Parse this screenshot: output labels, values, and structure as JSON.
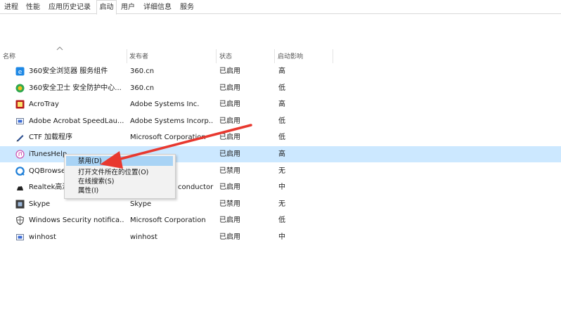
{
  "tabs": [
    "进程",
    "性能",
    "应用历史记录",
    "启动",
    "用户",
    "详细信息",
    "服务"
  ],
  "active_tab": "启动",
  "columns": {
    "name": "名称",
    "publisher": "发布者",
    "status": "状态",
    "impact": "启动影响"
  },
  "rows": [
    {
      "name": "360安全浏览器 服务组件",
      "publisher": "360.cn",
      "status": "已启用",
      "impact": "高",
      "icon": "360-browser-icon"
    },
    {
      "name": "360安全卫士 安全防护中心...",
      "publisher": "360.cn",
      "status": "已启用",
      "impact": "低",
      "icon": "360-safe-icon"
    },
    {
      "name": "AcroTray",
      "publisher": "Adobe Systems Inc.",
      "status": "已启用",
      "impact": "高",
      "icon": "acrotray-icon"
    },
    {
      "name": "Adobe Acrobat SpeedLau...",
      "publisher": "Adobe Systems Incorp...",
      "status": "已启用",
      "impact": "低",
      "icon": "generic-app-icon"
    },
    {
      "name": "CTF 加载程序",
      "publisher": "Microsoft Corporation",
      "status": "已启用",
      "impact": "低",
      "icon": "pen-icon"
    },
    {
      "name": "iTunesHelp",
      "publisher": "",
      "status": "已启用",
      "impact": "高",
      "icon": "itunes-icon",
      "selected": true
    },
    {
      "name": "QQBrowse",
      "publisher": "",
      "status": "已禁用",
      "impact": "无",
      "icon": "qqbrowser-icon"
    },
    {
      "name": "Realtek高清",
      "publisher": "conductor",
      "status": "已启用",
      "impact": "中",
      "icon": "realtek-icon"
    },
    {
      "name": "Skype",
      "publisher": "Skype",
      "status": "已禁用",
      "impact": "无",
      "icon": "skype-icon"
    },
    {
      "name": "Windows Security notifica...",
      "publisher": "Microsoft Corporation",
      "status": "已启用",
      "impact": "低",
      "icon": "shield-icon"
    },
    {
      "name": "winhost",
      "publisher": "winhost",
      "status": "已启用",
      "impact": "中",
      "icon": "generic-app-icon"
    }
  ],
  "context_menu": {
    "items": [
      "禁用(D)",
      "打开文件所在的位置(O)",
      "在线搜索(S)",
      "属性(I)"
    ],
    "highlighted_index": 0
  },
  "colors": {
    "selected_row": "#cce8ff",
    "menu_highlight": "#a8d3f5",
    "annotation_arrow": "#e8382f"
  }
}
